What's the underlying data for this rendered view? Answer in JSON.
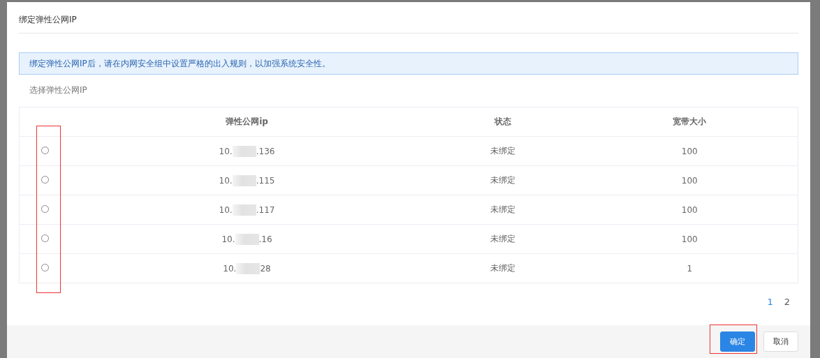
{
  "dialog": {
    "title": "绑定弹性公网IP",
    "notice": "绑定弹性公网IP后，请在内网安全组中设置严格的出入规则，以加强系统安全性。",
    "section_label": "选择弹性公网IP",
    "table": {
      "columns": [
        "弹性公网ip",
        "状态",
        "宽带大小"
      ],
      "radio_column_highlighted": true,
      "rows": [
        {
          "selected": false,
          "ip_prefix": "10.",
          "ip_suffix": ".136",
          "status": "未绑定",
          "bandwidth": "100"
        },
        {
          "selected": false,
          "ip_prefix": "10.",
          "ip_suffix": ".115",
          "status": "未绑定",
          "bandwidth": "100"
        },
        {
          "selected": false,
          "ip_prefix": "10.",
          "ip_suffix": ".117",
          "status": "未绑定",
          "bandwidth": "100"
        },
        {
          "selected": false,
          "ip_prefix": "10.",
          "ip_suffix": ".16",
          "status": "未绑定",
          "bandwidth": "100"
        },
        {
          "selected": false,
          "ip_prefix": "10.",
          "ip_suffix": "28",
          "status": "未绑定",
          "bandwidth": "1"
        }
      ]
    },
    "pagination": [
      {
        "label": "1",
        "selected": true
      },
      {
        "label": "2",
        "selected": false
      }
    ],
    "buttons": [
      {
        "label": "确定",
        "kind": "primary",
        "highlighted": true
      },
      {
        "label": "取消",
        "kind": "default",
        "highlighted": false
      }
    ]
  }
}
